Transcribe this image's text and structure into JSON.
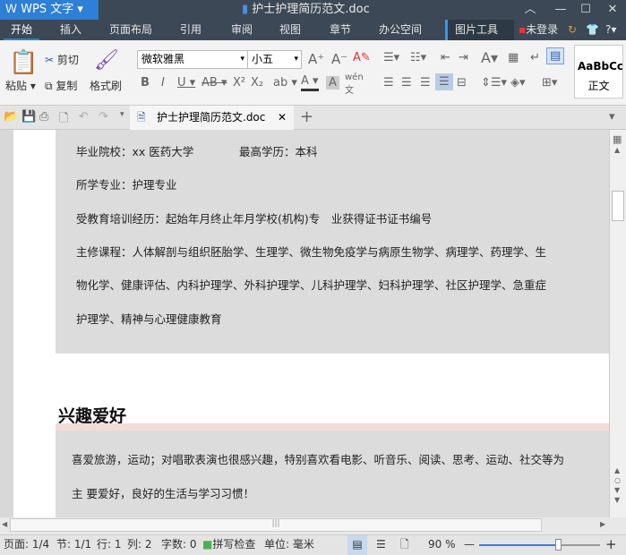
{
  "app": {
    "name": "WPS 文字",
    "title": "护士护理简历范文.doc"
  },
  "tabs": [
    "开始",
    "插入",
    "页面布局",
    "引用",
    "审阅",
    "视图",
    "章节",
    "办公空间",
    "图片工具"
  ],
  "account": {
    "login": "未登录"
  },
  "ribbon": {
    "paste": "粘贴",
    "cut": "剪切",
    "copy": "复制",
    "format_painter": "格式刷",
    "font": "微软雅黑",
    "size": "小五",
    "style_preview": "AaBbCc",
    "style_name": "正文"
  },
  "doc_tab": "护士护理简历范文.doc",
  "content": {
    "lines": [
      "毕业院校：xx 医药大学",
      "最高学历：本科",
      "所学专业：护理专业",
      "受教育培训经历：起始年月终止年月学校(机构)专　业获得证书证书编号",
      "主修课程：人体解剖与组织胚胎学、生理学、微生物免疫学与病原生物学、病理学、药理学、生",
      "物化学、健康评估、内科护理学、外科护理学、儿科护理学、妇科护理学、社区护理学、急重症",
      "护理学、精神与心理健康教育"
    ],
    "heading": "兴趣爱好",
    "hobby": [
      "喜爱旅游，运动；对唱歌表演也很感兴趣，特别喜欢看电影、听音乐、阅读、思考、运动、社交等为",
      "主 要爱好，良好的生活与学习习惯！"
    ]
  },
  "status": {
    "page": "页面: 1/4",
    "section": "节: 1/1",
    "row": "行: 1",
    "col": "列: 2",
    "words": "字数: 0",
    "spell": "拼写检查",
    "unit": "单位: 毫米",
    "zoom": "90 %",
    "zoom_fraction": 0.66
  }
}
